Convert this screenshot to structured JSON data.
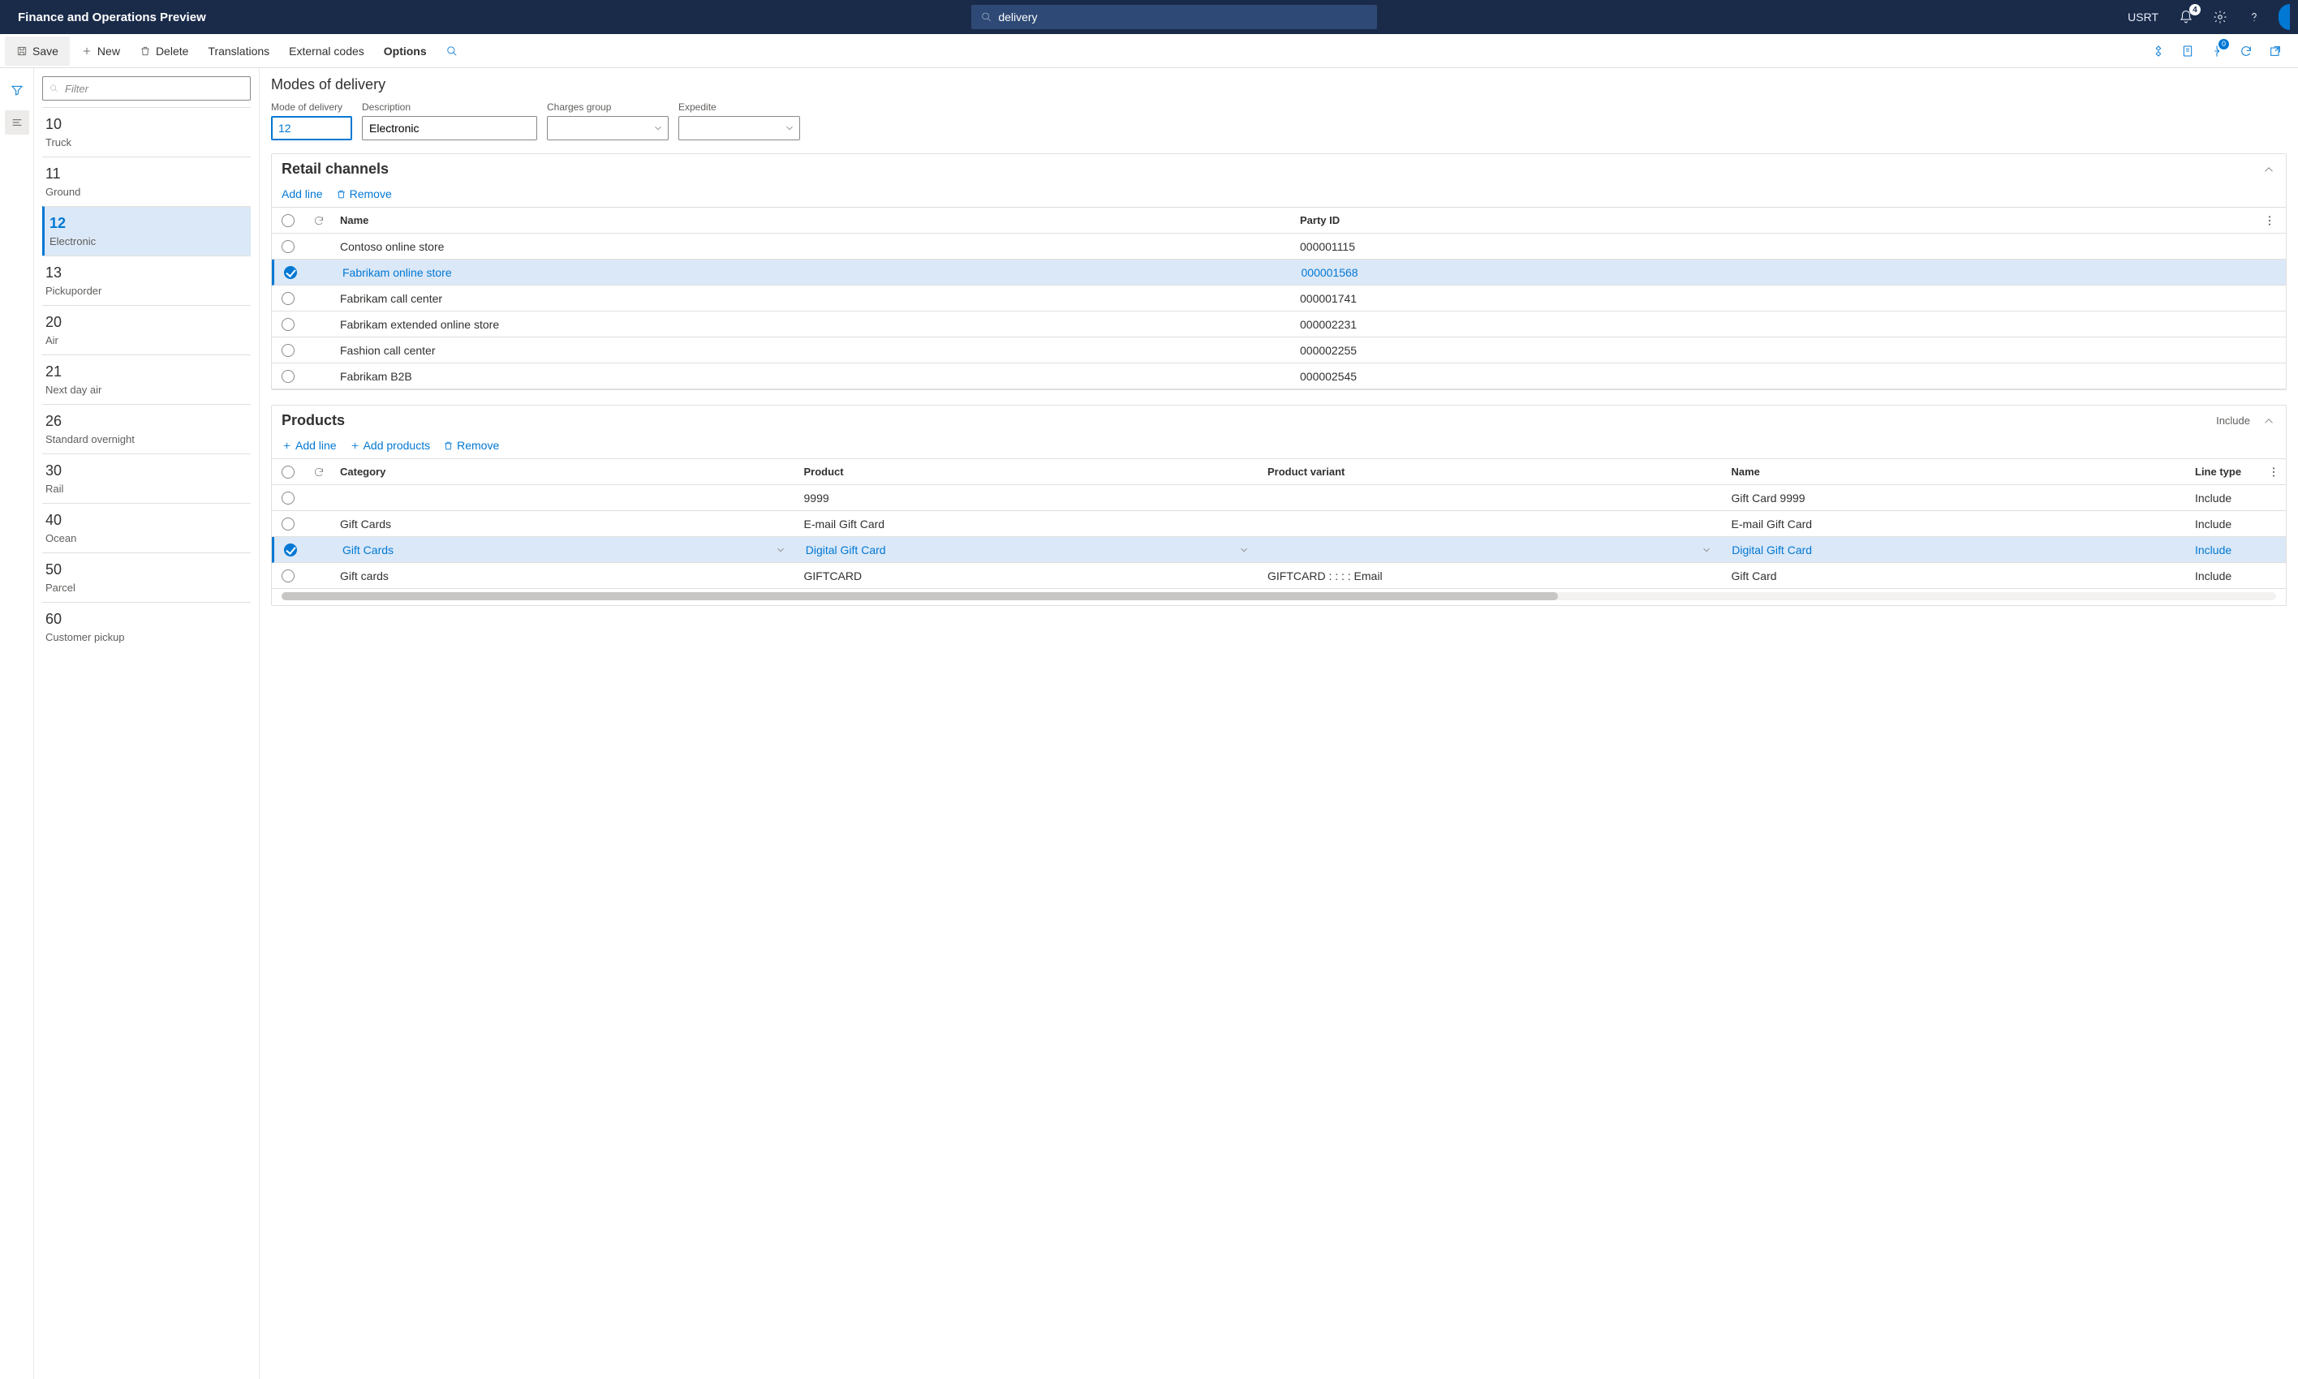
{
  "header": {
    "brand": "Finance and Operations Preview",
    "search_value": "delivery",
    "company": "USRT",
    "notification_count": "4",
    "attach_count": "0"
  },
  "actionbar": {
    "save": "Save",
    "new": "New",
    "delete": "Delete",
    "translations": "Translations",
    "external_codes": "External codes",
    "options": "Options"
  },
  "sidepane": {
    "filter_placeholder": "Filter",
    "modes": [
      {
        "code": "10",
        "desc": "Truck"
      },
      {
        "code": "11",
        "desc": "Ground"
      },
      {
        "code": "12",
        "desc": "Electronic",
        "selected": true
      },
      {
        "code": "13",
        "desc": "Pickuporder"
      },
      {
        "code": "20",
        "desc": "Air"
      },
      {
        "code": "21",
        "desc": "Next day air"
      },
      {
        "code": "26",
        "desc": "Standard overnight"
      },
      {
        "code": "30",
        "desc": "Rail"
      },
      {
        "code": "40",
        "desc": "Ocean"
      },
      {
        "code": "50",
        "desc": "Parcel"
      },
      {
        "code": "60",
        "desc": "Customer pickup"
      }
    ]
  },
  "main": {
    "title": "Modes of delivery",
    "form": {
      "mode_label": "Mode of delivery",
      "mode_value": "12",
      "desc_label": "Description",
      "desc_value": "Electronic",
      "charges_label": "Charges group",
      "charges_value": "",
      "expedite_label": "Expedite",
      "expedite_value": ""
    },
    "retail": {
      "title": "Retail channels",
      "add_line": "Add line",
      "remove": "Remove",
      "col_name": "Name",
      "col_party": "Party ID",
      "rows": [
        {
          "name": "Contoso online store",
          "party": "000001115"
        },
        {
          "name": "Fabrikam online store",
          "party": "000001568",
          "selected": true
        },
        {
          "name": "Fabrikam call center",
          "party": "000001741"
        },
        {
          "name": "Fabrikam extended online store",
          "party": "000002231"
        },
        {
          "name": "Fashion call center",
          "party": "000002255"
        },
        {
          "name": "Fabrikam B2B",
          "party": "000002545"
        }
      ]
    },
    "products": {
      "title": "Products",
      "include": "Include",
      "add_line": "Add line",
      "add_products": "Add products",
      "remove": "Remove",
      "col_category": "Category",
      "col_product": "Product",
      "col_variant": "Product variant",
      "col_name": "Name",
      "col_linetype": "Line type",
      "rows": [
        {
          "category": "",
          "product": "9999",
          "variant": "",
          "name": "Gift Card 9999",
          "linetype": "Include"
        },
        {
          "category": "Gift Cards",
          "product": "E-mail Gift Card",
          "variant": "",
          "name": "E-mail Gift Card",
          "linetype": "Include"
        },
        {
          "category": "Gift Cards",
          "product": "Digital Gift Card",
          "variant": "",
          "name": "Digital Gift Card",
          "linetype": "Include",
          "selected": true,
          "combos": true
        },
        {
          "category": "Gift cards",
          "product": "GIFTCARD",
          "variant": "GIFTCARD :  :  :  : Email",
          "name": "Gift Card",
          "linetype": "Include"
        }
      ]
    }
  }
}
